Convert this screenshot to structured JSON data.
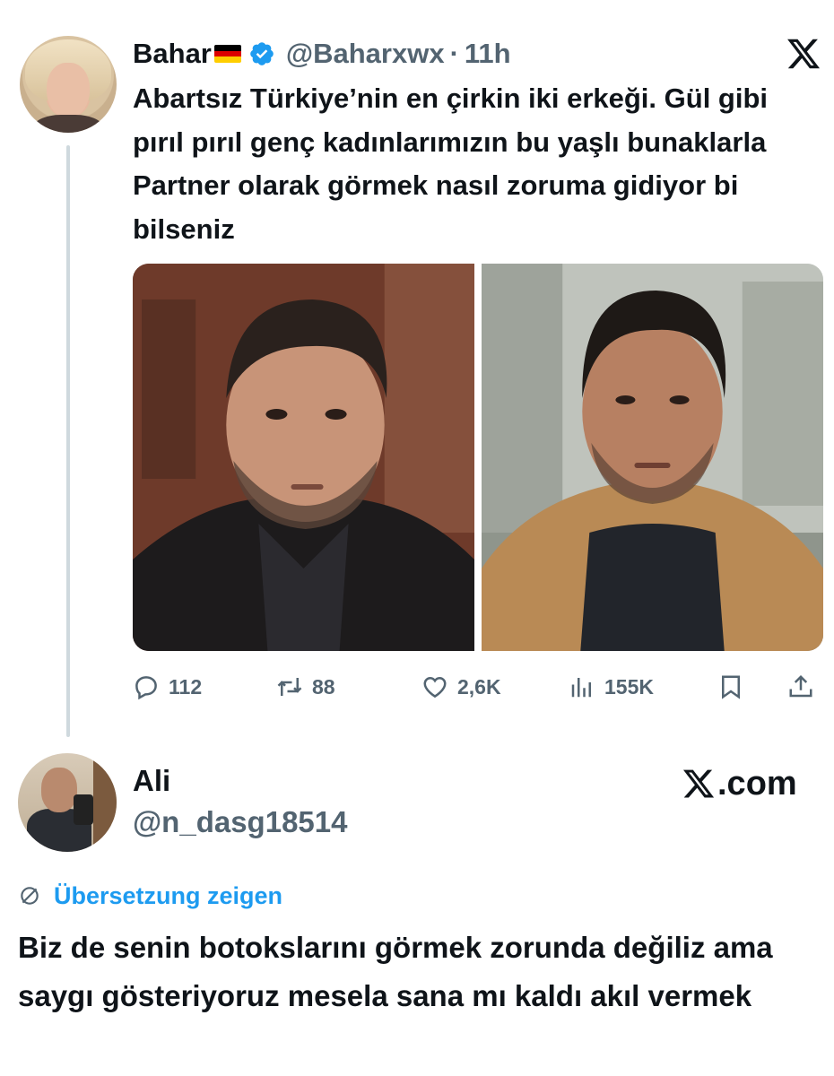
{
  "quoted_tweet": {
    "display_name": "Bahar",
    "flag": "germany-flag",
    "handle": "@Baharxwx",
    "separator": "·",
    "time": "11h",
    "text": "Abartsız Türkiye’nin en çirkin iki erkeği. Gül gibi pırıl pırıl genç kadınlarımızın bu yaşlı bunaklarla Partner olarak görmek nasıl zoruma gidiyor bi bilseniz",
    "media_count": 2,
    "actions": {
      "replies": "112",
      "retweets": "88",
      "likes": "2,6K",
      "views": "155K"
    }
  },
  "reply": {
    "display_name": "Ali",
    "handle": "@n_dasg18514",
    "source_label": ".com",
    "translate_label": "Übersetzung zeigen",
    "text": "Biz de senin botokslarını görmek zorunda değiliz ama saygı gösteriyoruz mesela sana mı kaldı akıl vermek"
  },
  "colors": {
    "text": "#0f1419",
    "secondary": "#536471",
    "accent": "#1d9bf0",
    "thread_line": "#cfd9de"
  },
  "icons": [
    "verified-badge-icon",
    "x-logo-icon",
    "reply-icon",
    "retweet-icon",
    "like-icon",
    "views-icon",
    "bookmark-icon",
    "share-icon",
    "translate-icon"
  ]
}
